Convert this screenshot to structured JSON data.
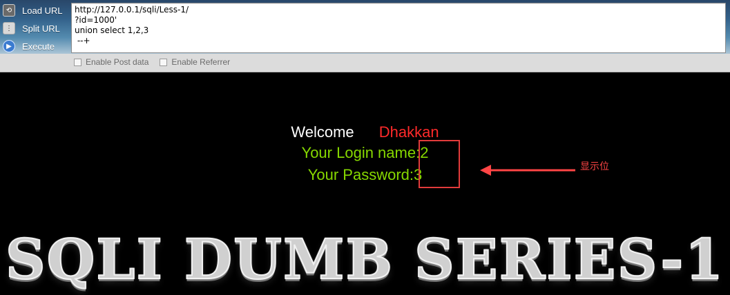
{
  "hackbar": {
    "load_url_label": "Load URL",
    "split_url_label": "Split URL",
    "execute_label": "Execute",
    "url_text_lines": [
      "http://127.0.0.1/sqli/Less-1/",
      "?id=1000'",
      "union select 1,2,3",
      " --+"
    ],
    "enable_post_label": "Enable Post data",
    "enable_referrer_label": "Enable Referrer"
  },
  "page": {
    "welcome_text": "Welcome",
    "username_text": "Dhakkan",
    "login_line": "Your Login name:2",
    "password_line": "Your Password:3",
    "annotation_text": "显示位",
    "banner_text": "SQLI DUMB SERIES-1"
  },
  "colors": {
    "login_green": "#86d800",
    "welcome_red": "#ff2a2a",
    "annotation_red": "#ff4545"
  },
  "icons": {
    "load_url": "load-url-icon",
    "split_url": "split-url-icon",
    "execute": "execute-icon"
  }
}
